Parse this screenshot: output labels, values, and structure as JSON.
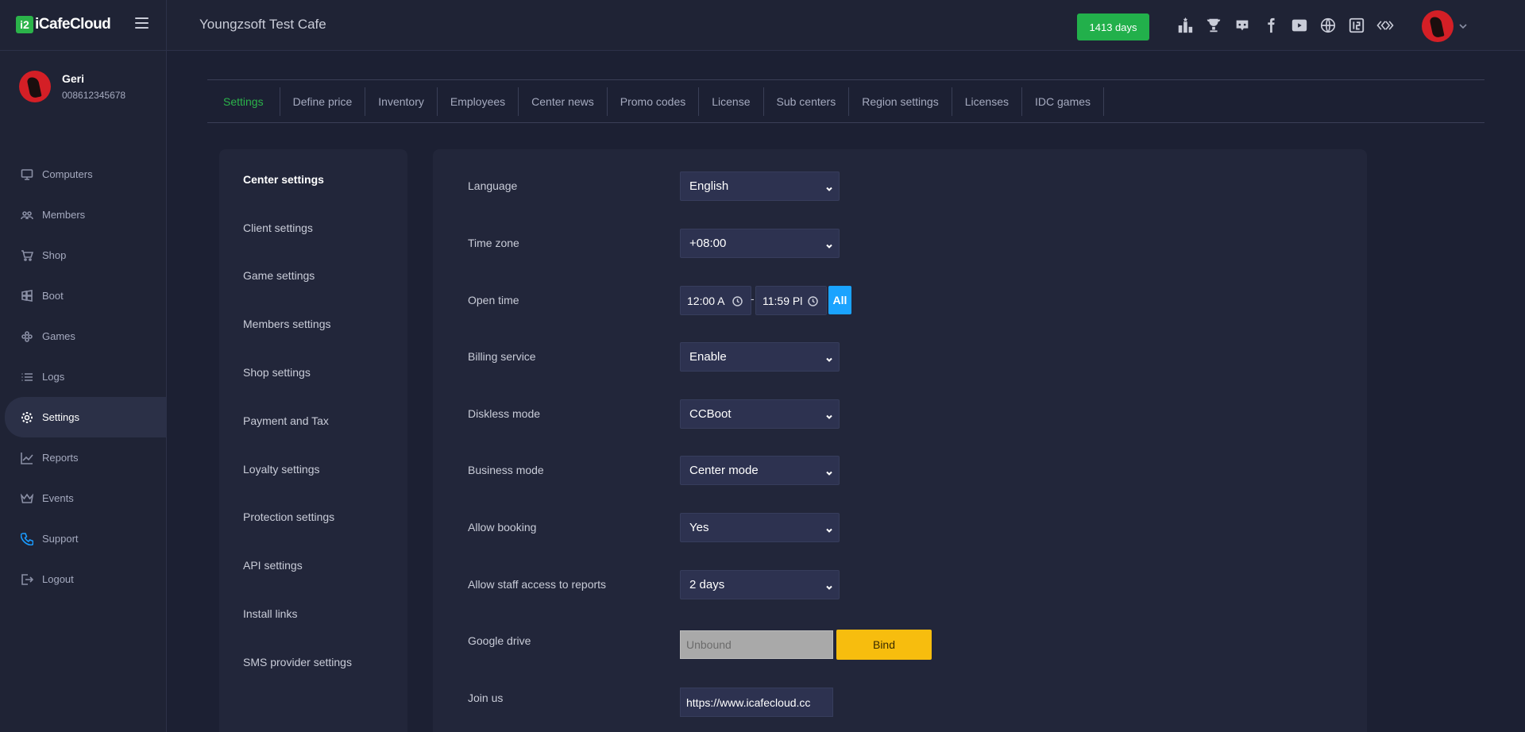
{
  "app": {
    "logo_text": "iCafeCloud",
    "logo_mark": "i2"
  },
  "header": {
    "cafe_title": "Youngzsoft Test Cafe",
    "days_badge": "1413 days",
    "icons": [
      "ranking-icon",
      "trophy-icon",
      "discord-icon",
      "facebook-icon",
      "youtube-icon",
      "globe-icon",
      "icafe-icon",
      "ccboot-icon"
    ]
  },
  "user": {
    "name": "Geri",
    "phone": "008612345678"
  },
  "sidebar": {
    "items": [
      {
        "label": "Computers",
        "icon": "monitor-icon"
      },
      {
        "label": "Members",
        "icon": "users-icon"
      },
      {
        "label": "Shop",
        "icon": "cart-icon"
      },
      {
        "label": "Boot",
        "icon": "windows-icon"
      },
      {
        "label": "Games",
        "icon": "gamepad-icon"
      },
      {
        "label": "Logs",
        "icon": "list-icon"
      },
      {
        "label": "Settings",
        "icon": "gear-icon"
      },
      {
        "label": "Reports",
        "icon": "chart-icon"
      },
      {
        "label": "Events",
        "icon": "crown-icon"
      },
      {
        "label": "Support",
        "icon": "phone-icon"
      },
      {
        "label": "Logout",
        "icon": "logout-icon"
      }
    ],
    "active": "Settings"
  },
  "tabs": [
    "Settings",
    "Define price",
    "Inventory",
    "Employees",
    "Center news",
    "Promo codes",
    "License",
    "Sub centers",
    "Region settings",
    "Licenses",
    "IDC games"
  ],
  "active_tab": "Settings",
  "subsettings": [
    "Center settings",
    "Client settings",
    "Game settings",
    "Members settings",
    "Shop settings",
    "Payment and Tax",
    "Loyalty settings",
    "Protection settings",
    "API settings",
    "Install links",
    "SMS provider settings"
  ],
  "active_subsetting": "Center settings",
  "form": {
    "language": {
      "label": "Language",
      "value": "English"
    },
    "timezone": {
      "label": "Time zone",
      "value": "+08:00"
    },
    "open_time": {
      "label": "Open time",
      "start": "12:00 A",
      "end": "11:59 Pl",
      "all_label": "All",
      "separator": "-"
    },
    "billing": {
      "label": "Billing service",
      "value": "Enable"
    },
    "diskless": {
      "label": "Diskless mode",
      "value": "CCBoot"
    },
    "business": {
      "label": "Business mode",
      "value": "Center mode"
    },
    "booking": {
      "label": "Allow booking",
      "value": "Yes"
    },
    "staff_reports": {
      "label": "Allow staff access to reports",
      "value": "2 days"
    },
    "google_drive": {
      "label": "Google drive",
      "placeholder": "Unbound",
      "bind_label": "Bind"
    },
    "join_us": {
      "label": "Join us",
      "value": "https://www.icafecloud.cc"
    }
  }
}
